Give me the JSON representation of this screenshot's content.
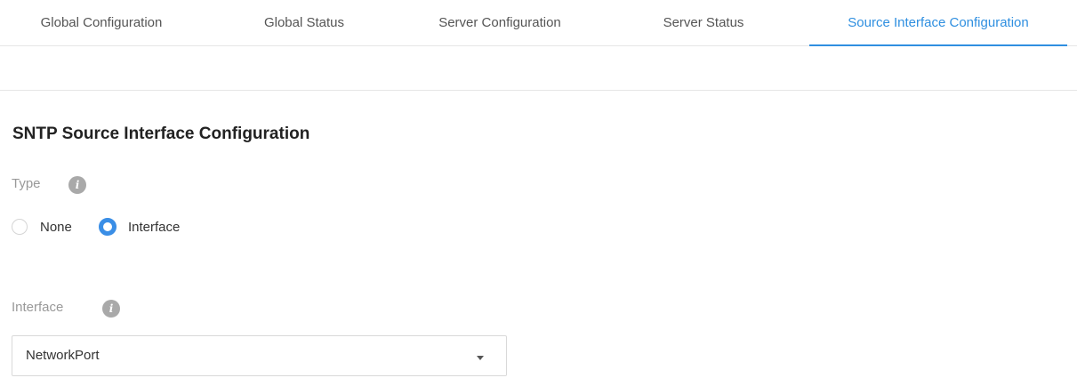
{
  "tabs": [
    {
      "label": "Global Configuration",
      "active": false
    },
    {
      "label": "Global Status",
      "active": false
    },
    {
      "label": "Server Configuration",
      "active": false
    },
    {
      "label": "Server Status",
      "active": false
    },
    {
      "label": "Source Interface Configuration",
      "active": true
    }
  ],
  "section": {
    "title": "SNTP Source Interface Configuration"
  },
  "type_field": {
    "label": "Type",
    "info_icon": "info-icon",
    "options": [
      {
        "label": "None",
        "selected": false
      },
      {
        "label": "Interface",
        "selected": true
      }
    ]
  },
  "interface_field": {
    "label": "Interface",
    "info_icon": "info-icon",
    "value": "NetworkPort"
  },
  "colors": {
    "accent": "#2f8fe0",
    "radio_selected": "#3a8ee6",
    "label_muted": "#999999",
    "info_icon_bg": "#a9a9a9"
  }
}
